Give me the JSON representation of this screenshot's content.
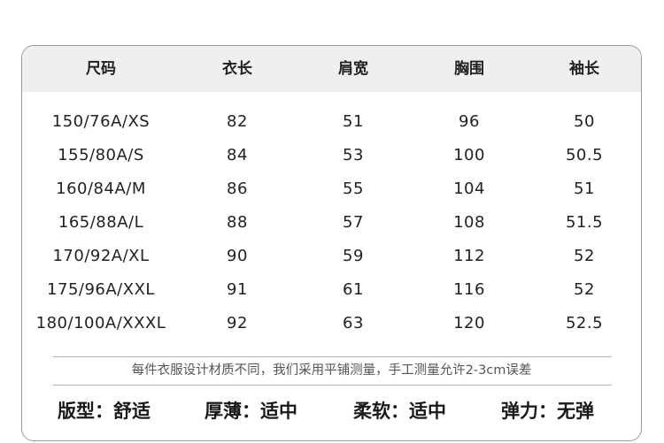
{
  "headers": [
    "尺码",
    "衣长",
    "肩宽",
    "胸围",
    "袖长"
  ],
  "rows": [
    [
      "150/76A/XS",
      "82",
      "51",
      "96",
      "50"
    ],
    [
      "155/80A/S",
      "84",
      "53",
      "100",
      "50.5"
    ],
    [
      "160/84A/M",
      "86",
      "55",
      "104",
      "51"
    ],
    [
      "165/88A/L",
      "88",
      "57",
      "108",
      "51.5"
    ],
    [
      "170/92A/XL",
      "90",
      "59",
      "112",
      "52"
    ],
    [
      "175/96A/XXL",
      "91",
      "61",
      "116",
      "52"
    ],
    [
      "180/100A/XXXL",
      "92",
      "63",
      "120",
      "52.5"
    ]
  ],
  "note": "每件衣服设计材质不同，我们采用平铺测量，手工测量允许2-3cm误差",
  "properties": [
    "版型：舒适",
    "厚薄：适中",
    "柔软：适中",
    "弹力：无弹"
  ]
}
